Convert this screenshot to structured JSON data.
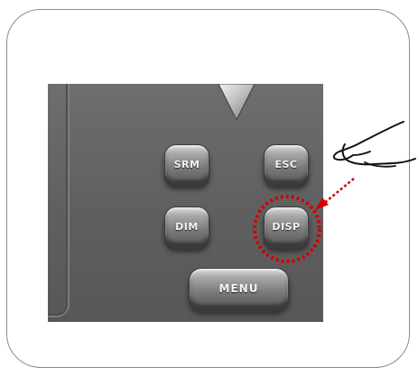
{
  "panel": {
    "buttons": {
      "srm": "SRM",
      "esc": "ESC",
      "dim": "DIM",
      "disp": "DISP",
      "menu": "MENU"
    },
    "highlighted_button": "DISP"
  },
  "annotations": {
    "highlight_color": "#d40000",
    "icons": [
      "down-triangle-icon",
      "hand-pointer-icon",
      "dashed-arrow-icon",
      "dashed-circle-highlight"
    ]
  },
  "colors": {
    "panel": "#666666",
    "button_text": "#f4f4f4",
    "frame_border": "#8c8c8c"
  }
}
